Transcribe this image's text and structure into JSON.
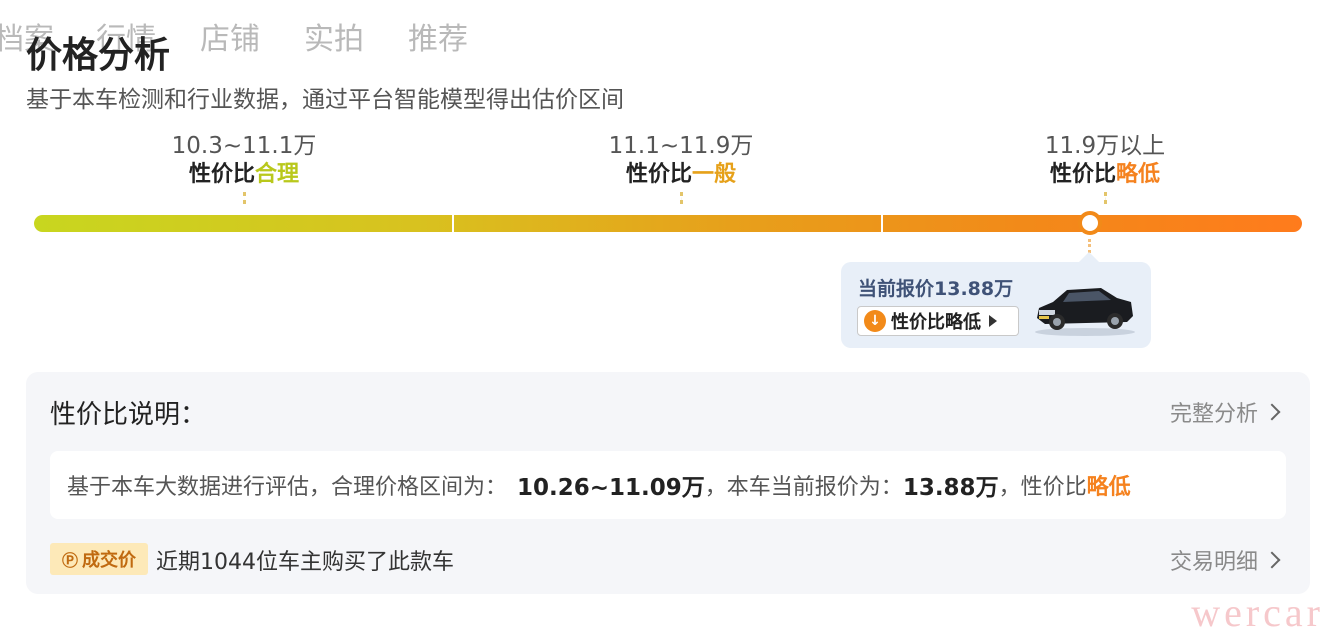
{
  "tabs": [
    {
      "label": "档案"
    },
    {
      "label": "行情"
    },
    {
      "label": "店铺"
    },
    {
      "label": "实拍"
    },
    {
      "label": "推荐"
    }
  ],
  "title": "价格分析",
  "subtitle": "基于本车检测和行业数据，通过平台智能模型得出估价区间",
  "segments": [
    {
      "range": "10.3~11.1万",
      "prefix": "性价比",
      "tag": "合理",
      "tag_color": "#b9c81c"
    },
    {
      "range": "11.1~11.9万",
      "prefix": "性价比",
      "tag": "一般",
      "tag_color": "#e6a11a"
    },
    {
      "range": "11.9万以上",
      "prefix": "性价比",
      "tag": "略低",
      "tag_color": "#f5821f"
    }
  ],
  "callout": {
    "price_text": "当前报价13.88万",
    "button_label": "性价比略低"
  },
  "panel": {
    "title": "性价比说明：",
    "full_analysis_link": "完整分析",
    "desc_prefix": "基于本车大数据进行评估，合理价格区间为：",
    "fair_range": "10.26~11.09万",
    "desc_mid": "，本车当前报价为：",
    "current_price": "13.88万",
    "desc_suffix": "，性价比",
    "verdict": "略低",
    "deal_badge": "成交价",
    "deal_text": "近期1044位车主购买了此款车",
    "deal_link": "交易明细"
  },
  "watermark": "wercar",
  "colors": {
    "accent_orange": "#f5821f",
    "panel_bg": "#f5f6f9",
    "callout_bg": "#e8eff8"
  }
}
